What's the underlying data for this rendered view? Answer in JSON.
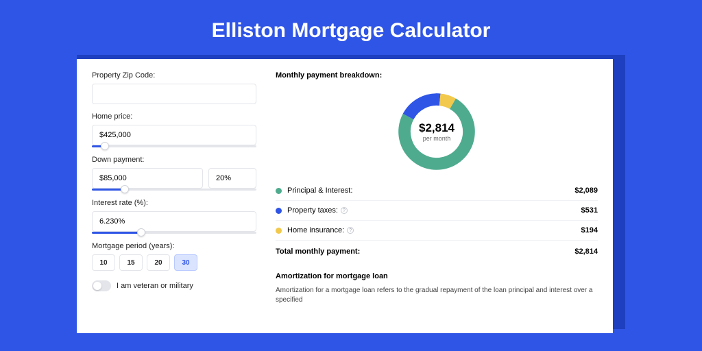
{
  "page": {
    "title": "Elliston Mortgage Calculator"
  },
  "colors": {
    "green": "#4fab8e",
    "blue": "#2f55e6",
    "yellow": "#f2c94c"
  },
  "form": {
    "zip": {
      "label": "Property Zip Code:",
      "value": ""
    },
    "price": {
      "label": "Home price:",
      "value": "$425,000",
      "slider_pct": 8
    },
    "down": {
      "label": "Down payment:",
      "amount": "$85,000",
      "pct": "20%",
      "slider_pct": 20
    },
    "rate": {
      "label": "Interest rate (%):",
      "value": "6.230%",
      "slider_pct": 30
    },
    "period": {
      "label": "Mortgage period (years):",
      "options": [
        "10",
        "15",
        "20",
        "30"
      ],
      "active": "30"
    },
    "veteran": {
      "label": "I am veteran or military"
    }
  },
  "breakdown": {
    "title": "Monthly payment breakdown:",
    "center_amount": "$2,814",
    "center_sub": "per month",
    "items": [
      {
        "label": "Principal & Interest:",
        "value": "$2,089",
        "color": "#4fab8e",
        "info": false,
        "angle": 267
      },
      {
        "label": "Property taxes:",
        "value": "$531",
        "color": "#2f55e6",
        "info": true,
        "angle": 68
      },
      {
        "label": "Home insurance:",
        "value": "$194",
        "color": "#f2c94c",
        "info": true,
        "angle": 25
      }
    ],
    "total_label": "Total monthly payment:",
    "total_value": "$2,814"
  },
  "amort": {
    "title": "Amortization for mortgage loan",
    "text": "Amortization for a mortgage loan refers to the gradual repayment of the loan principal and interest over a specified"
  },
  "chart_data": {
    "type": "pie",
    "title": "Monthly payment breakdown",
    "categories": [
      "Principal & Interest",
      "Property taxes",
      "Home insurance"
    ],
    "values": [
      2089,
      531,
      194
    ],
    "total": 2814,
    "unit": "USD/month"
  }
}
